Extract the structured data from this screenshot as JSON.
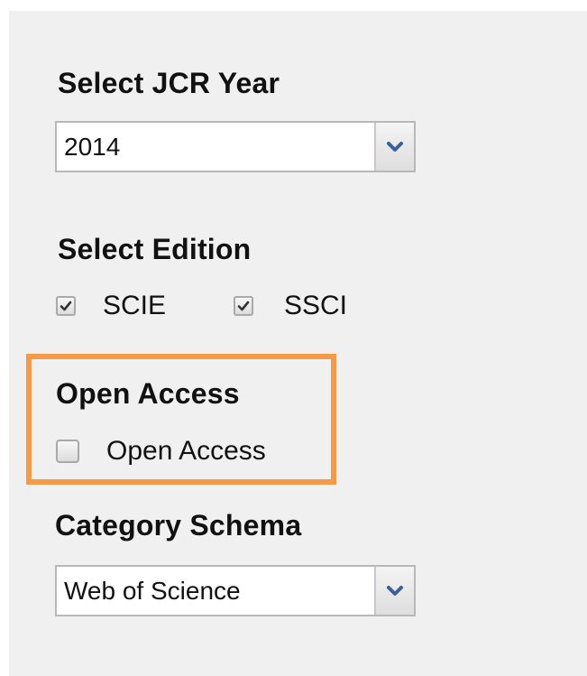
{
  "jcr_year": {
    "title": "Select JCR Year",
    "selected": "2014"
  },
  "edition": {
    "title": "Select Edition",
    "options": [
      {
        "label": "SCIE",
        "checked": true
      },
      {
        "label": "SSCI",
        "checked": true
      }
    ]
  },
  "open_access": {
    "title": "Open Access",
    "option_label": "Open Access",
    "checked": false,
    "highlight_color": "#f59a47"
  },
  "category_schema": {
    "title": "Category Schema",
    "selected": "Web of Science"
  },
  "icons": {
    "dropdown": "chevron-down-icon",
    "check": "checkmark-icon"
  },
  "colors": {
    "panel_bg": "#f0f0f0",
    "dropdown_arrow": "#3a5f9a"
  }
}
